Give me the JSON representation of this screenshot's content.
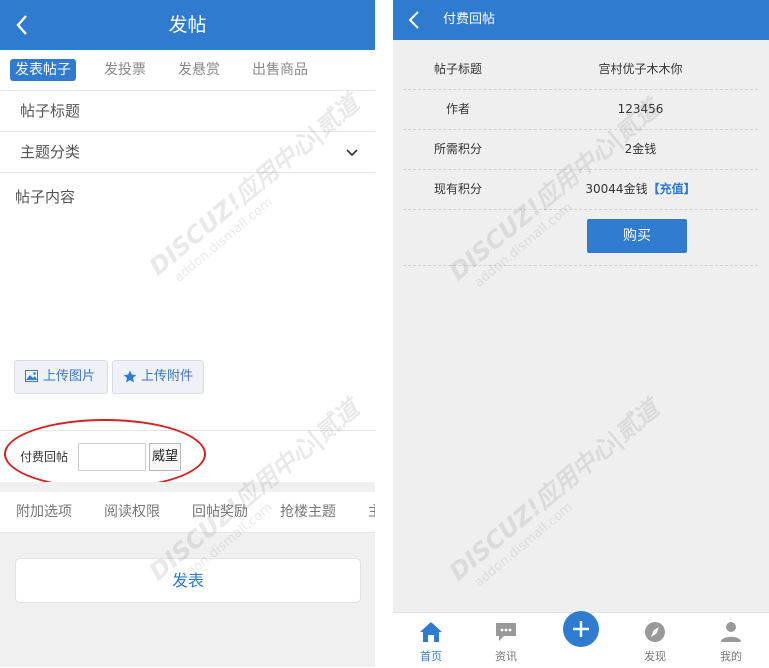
{
  "left": {
    "header": {
      "title": "发帖"
    },
    "tabs": [
      "发表帖子",
      "发投票",
      "发悬赏",
      "出售商品"
    ],
    "fields": {
      "title_placeholder": "帖子标题",
      "category_placeholder": "主题分类",
      "content_placeholder": "帖子内容"
    },
    "upload": {
      "image_label": "上传图片",
      "attach_label": "上传附件"
    },
    "paid_reply": {
      "label": "付费回帖",
      "value": "",
      "unit": "威望"
    },
    "options": [
      "附加选项",
      "阅读权限",
      "回帖奖励",
      "抢楼主题",
      "主"
    ],
    "submit_label": "发表"
  },
  "right": {
    "header": {
      "title": "付费回帖"
    },
    "rows": [
      {
        "key": "帖子标题",
        "value": "宫村优子木木你"
      },
      {
        "key": "作者",
        "value": "123456"
      },
      {
        "key": "所需积分",
        "value": "2金钱"
      },
      {
        "key": "现有积分",
        "value": "30044金钱",
        "link": "【充值】"
      }
    ],
    "buy_label": "购买",
    "tabbar": [
      "首页",
      "资讯",
      "发现",
      "我的"
    ]
  },
  "watermark": {
    "brand": "DISCUZ!应用中心|贰道",
    "url": "addon.dismall.com"
  },
  "colors": {
    "accent": "#2f7bd0",
    "annotation": "#d72020",
    "background": "#efefef"
  }
}
